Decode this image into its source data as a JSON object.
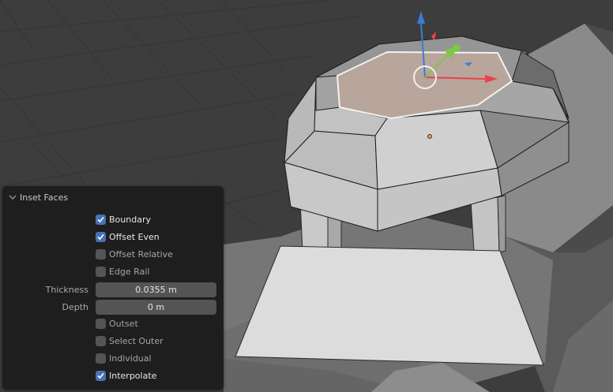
{
  "panel": {
    "title": "Inset Faces",
    "options": [
      {
        "label": "Boundary",
        "checked": true
      },
      {
        "label": "Offset Even",
        "checked": true
      },
      {
        "label": "Offset Relative",
        "checked": false
      },
      {
        "label": "Edge Rail",
        "checked": false
      }
    ],
    "thickness": {
      "label": "Thickness",
      "value": "0.0355 m"
    },
    "depth": {
      "label": "Depth",
      "value": "0 m"
    },
    "options2": [
      {
        "label": "Outset",
        "checked": false
      },
      {
        "label": "Select Outer",
        "checked": false
      },
      {
        "label": "Individual",
        "checked": false
      },
      {
        "label": "Interpolate",
        "checked": true
      }
    ]
  },
  "colors": {
    "background": "#3d3d3d",
    "panel": "#1e1e1e",
    "checkbox_on": "#4772b3",
    "checkbox_off": "#545454",
    "selected_face": "#b8a59b",
    "gizmo_x": "#e8434e",
    "gizmo_y": "#7ec648",
    "gizmo_z": "#3b7bd8"
  }
}
